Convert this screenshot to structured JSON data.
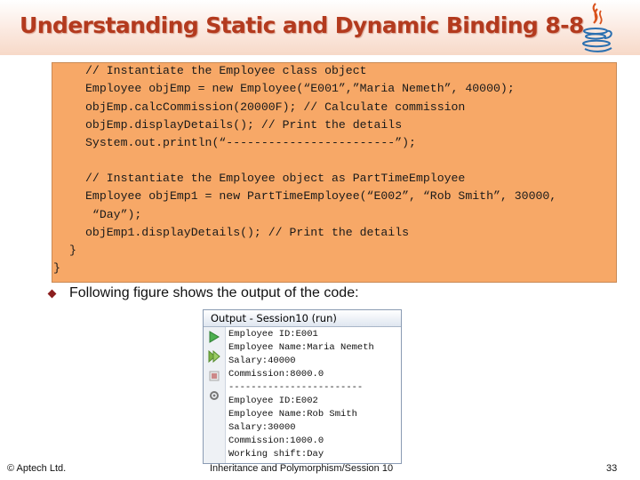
{
  "slide": {
    "title": "Understanding Static and Dynamic Binding 8-8",
    "bullet": "Following figure shows the output of the code:"
  },
  "code": {
    "lines": [
      "// Instantiate the Employee class object",
      "Employee objEmp = new Employee(“E001”,”Maria Nemeth”, 40000);",
      "objEmp.calcCommission(20000F); // Calculate commission",
      "objEmp.displayDetails(); // Print the details",
      "System.out.println(“------------------------”);",
      "// Instantiate the Employee object as PartTimeEmployee",
      "Employee objEmp1 = new PartTimeEmployee(“E002”, “Rob Smith”, 30000,",
      " “Day”);",
      "objEmp1.displayDetails(); // Print the details",
      "}",
      "}"
    ]
  },
  "output_window": {
    "title": "Output - Session10 (run)",
    "lines": [
      "Employee ID:E001",
      "Employee Name:Maria Nemeth",
      "Salary:40000",
      "Commission:8000.0",
      "------------------------",
      "Employee ID:E002",
      "Employee Name:Rob Smith",
      "Salary:30000",
      "Commission:1000.0",
      "Working shift:Day"
    ],
    "gutter_icons": [
      "run-icon",
      "rerun-icon",
      "stop-icon",
      "settings-icon"
    ]
  },
  "footer": {
    "left": "© Aptech Ltd.",
    "center": "Inheritance and Polymorphism/Session 10",
    "page": "33"
  },
  "colors": {
    "title": "#b33a1e",
    "code_background": "#f7a867",
    "bullet": "#8b1e1e"
  }
}
